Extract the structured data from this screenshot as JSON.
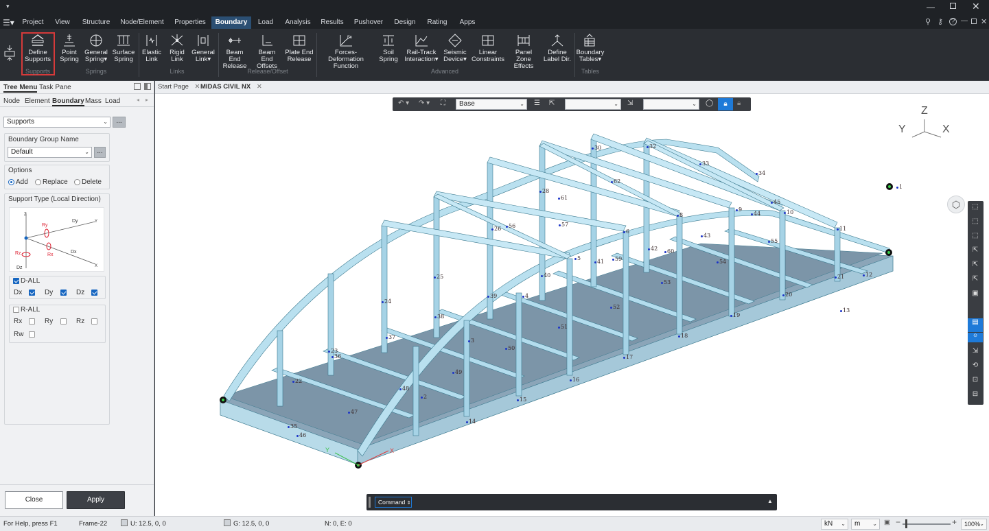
{
  "menu": {
    "items": [
      "Project",
      "View",
      "Structure",
      "Node/Element",
      "Properties",
      "Boundary",
      "Load",
      "Analysis",
      "Results",
      "Pushover",
      "Design",
      "Rating",
      "Apps"
    ],
    "active": "Boundary"
  },
  "ribbon": {
    "buttons": [
      {
        "id": "define-supports",
        "line1": "Define",
        "line2": "Supports"
      },
      {
        "id": "point-spring",
        "line1": "Point",
        "line2": "Spring"
      },
      {
        "id": "general-spring",
        "line1": "General",
        "line2": "Spring"
      },
      {
        "id": "surface-spring",
        "line1": "Surface",
        "line2": "Spring"
      },
      {
        "id": "elastic-link",
        "line1": "Elastic",
        "line2": "Link"
      },
      {
        "id": "rigid-link",
        "line1": "Rigid",
        "line2": "Link"
      },
      {
        "id": "general-link",
        "line1": "General",
        "line2": "Link"
      },
      {
        "id": "beam-end-release",
        "line1": "Beam End",
        "line2": "Release"
      },
      {
        "id": "beam-end-offsets",
        "line1": "Beam End",
        "line2": "Offsets"
      },
      {
        "id": "plate-end-release",
        "line1": "Plate End",
        "line2": "Release"
      },
      {
        "id": "forces-deformation",
        "line1": "Forces-Deformation",
        "line2": "Function"
      },
      {
        "id": "soil-spring",
        "line1": "Soil",
        "line2": "Spring"
      },
      {
        "id": "rail-track",
        "line1": "Rail-Track",
        "line2": "Interaction"
      },
      {
        "id": "seismic-device",
        "line1": "Seismic",
        "line2": "Device"
      },
      {
        "id": "linear-constraints",
        "line1": "Linear",
        "line2": "Constraints"
      },
      {
        "id": "panel-zone",
        "line1": "Panel Zone",
        "line2": "Effects"
      },
      {
        "id": "define-label-dir",
        "line1": "Define",
        "line2": "Label Dir."
      },
      {
        "id": "boundary-tables",
        "line1": "Boundary",
        "line2": "Tables"
      }
    ],
    "groups": {
      "supports": "Supports",
      "springs": "Springs",
      "links": "Links",
      "release_offset": "Release/Offset",
      "advanced": "Advanced",
      "tables": "Tables"
    }
  },
  "panel": {
    "top_tabs": [
      "Tree Menu",
      "Task Pane"
    ],
    "sub_tabs": [
      "Node",
      "Element",
      "Boundary",
      "Mass",
      "Load"
    ],
    "function_select": "Supports",
    "group_label": "Boundary Group Name",
    "group_value": "Default",
    "options_label": "Options",
    "options": [
      "Add",
      "Replace",
      "Delete"
    ],
    "support_type_label": "Support Type (Local Direction)",
    "diagram": {
      "z": "Z",
      "y": "Y",
      "x": "X",
      "dz": "Dz",
      "dy": "Dy",
      "dx": "Dx",
      "ry": "Ry",
      "rx": "Rx",
      "rz": "Rz"
    },
    "d_all": "D-ALL",
    "d_items": [
      "Dx",
      "Dy",
      "Dz"
    ],
    "r_all": "R-ALL",
    "r_items": [
      "Rx",
      "Ry",
      "Rz",
      "Rw"
    ],
    "close": "Close",
    "apply": "Apply",
    "dots": "..."
  },
  "doc_tabs": [
    "Start Page",
    "MIDAS CIVIL NX"
  ],
  "view_toolbar": {
    "base_select": "Base"
  },
  "axes": {
    "z": "Z",
    "y": "Y",
    "x": "X"
  },
  "command": {
    "label": "Command"
  },
  "status": {
    "help": "For Help, press F1",
    "frame": "Frame-22",
    "u": "U: 12.5, 0, 0",
    "g": "G: 12.5, 0, 0",
    "ne": "N: 0, E: 0",
    "force_unit": "kN",
    "length_unit": "m",
    "zoom": "100%"
  },
  "node_labels": [
    {
      "t": "1",
      "x": "70",
      "y": "235"
    },
    {
      "t": "2",
      "x": "73",
      "y": "229"
    },
    {
      "t": "3",
      "x": "89",
      "y": "226"
    },
    {
      "t": "4",
      "x": "80",
      "y": "253"
    },
    {
      "t": "5",
      "x": "78",
      "y": "249"
    },
    {
      "t": "6",
      "x": "84",
      "y": "231"
    },
    {
      "t": "8",
      "x": "21",
      "y": "270"
    },
    {
      "t": "9",
      "x": "98",
      "y": "308"
    },
    {
      "t": "10",
      "x": "122",
      "y": "328"
    },
    {
      "t": "11",
      "x": "75",
      "y": "287"
    },
    {
      "t": "12",
      "x": "117",
      "y": "328"
    },
    {
      "t": "13",
      "x": "67",
      "y": "265"
    },
    {
      "t": "14",
      "x": "86",
      "y": "230"
    },
    {
      "t": "15",
      "x": "90",
      "y": "220"
    },
    {
      "t": "16",
      "x": "88",
      "y": "218"
    },
    {
      "t": "17",
      "x": "47",
      "y": "258"
    },
    {
      "t": "18",
      "x": "70",
      "y": "275"
    },
    {
      "t": "19",
      "x": "96",
      "y": "318"
    },
    {
      "t": "20",
      "x": "121",
      "y": "324"
    },
    {
      "t": "21",
      "x": "40",
      "y": "318"
    },
    {
      "t": "22",
      "x": "25",
      "y": "235"
    },
    {
      "t": "23",
      "x": "83",
      "y": "216"
    },
    {
      "t": "24",
      "x": "74",
      "y": "213"
    },
    {
      "t": "25",
      "x": "117",
      "y": "237"
    },
    {
      "t": "26",
      "x": "71",
      "y": "213"
    },
    {
      "t": "28",
      "x": "72",
      "y": "241"
    },
    {
      "t": "30",
      "x": "121",
      "y": "209"
    },
    {
      "t": "32",
      "x": "77",
      "y": "245"
    },
    {
      "t": "33",
      "x": "76",
      "y": "233"
    },
    {
      "t": "34",
      "x": "77",
      "y": "240"
    },
    {
      "t": "35",
      "x": "127",
      "y": "221"
    },
    {
      "t": "36",
      "x": "97",
      "y": "236"
    },
    {
      "t": "37",
      "x": "88",
      "y": "233"
    },
    {
      "t": "38",
      "x": "115",
      "y": "236"
    },
    {
      "t": "39",
      "x": "74",
      "y": "238"
    },
    {
      "t": "40",
      "x": "118",
      "y": "225"
    },
    {
      "t": "41",
      "x": "128",
      "y": "215"
    },
    {
      "t": "42",
      "x": "91",
      "y": "228"
    },
    {
      "t": "43",
      "x": "105",
      "y": "230"
    },
    {
      "t": "44",
      "x": "66",
      "y": "263"
    },
    {
      "t": "45",
      "x": "71",
      "y": "273"
    },
    {
      "t": "46",
      "x": "92",
      "y": "262"
    },
    {
      "t": "47",
      "x": "89",
      "y": "286"
    },
    {
      "t": "48",
      "x": "124",
      "y": "320"
    },
    {
      "t": "49",
      "x": "129",
      "y": "332"
    },
    {
      "t": "50",
      "x": "63",
      "y": "267"
    },
    {
      "t": "51",
      "x": "85",
      "y": "262"
    },
    {
      "t": "52",
      "x": "120",
      "y": "274"
    },
    {
      "t": "53",
      "x": "83",
      "y": "254"
    },
    {
      "t": "54",
      "x": "112",
      "y": "287"
    },
    {
      "t": "55",
      "x": "77",
      "y": "309"
    },
    {
      "t": "56",
      "x": "128",
      "y": "315"
    },
    {
      "t": "57",
      "x": "106",
      "y": "304"
    },
    {
      "t": "59",
      "x": "113",
      "y": "303"
    },
    {
      "t": "60",
      "x": "109",
      "y": "301"
    },
    {
      "t": "61",
      "x": "122",
      "y": "302"
    },
    {
      "t": "62",
      "x": "42",
      "y": "312"
    }
  ]
}
